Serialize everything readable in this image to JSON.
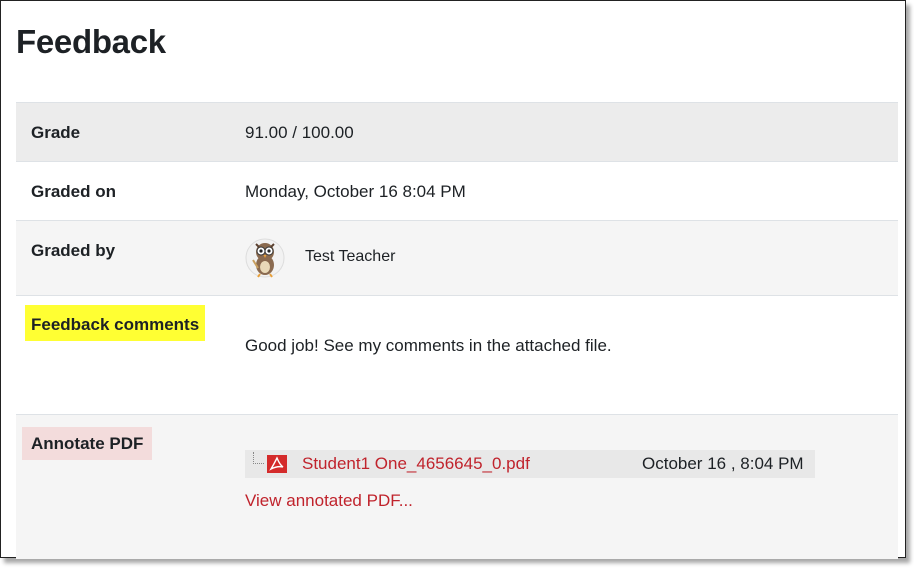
{
  "page": {
    "title": "Feedback"
  },
  "feedback": {
    "grade": {
      "label": "Grade",
      "value": "91.00 / 100.00"
    },
    "graded_on": {
      "label": "Graded on",
      "value": "Monday, October 16 8:04 PM"
    },
    "graded_by": {
      "label": "Graded by",
      "teacher_name": "Test Teacher",
      "avatar_icon": "owl-teacher-avatar"
    },
    "comments": {
      "label": "Feedback comments",
      "text": "Good job! See my comments in the attached file.",
      "highlight_color": "#ffff33"
    },
    "annotate_pdf": {
      "label": "Annotate PDF",
      "highlight_color": "#f3dcdc",
      "file": {
        "icon": "pdf-icon",
        "name": "Student1 One_4656645_0.pdf",
        "date": "October 16 , 8:04 PM"
      },
      "view_link": "View annotated PDF..."
    }
  },
  "colors": {
    "link": "#c0232c",
    "text": "#1d2125",
    "grade_row_bg": "#ececec",
    "alt_row_bg": "#f5f5f5"
  }
}
